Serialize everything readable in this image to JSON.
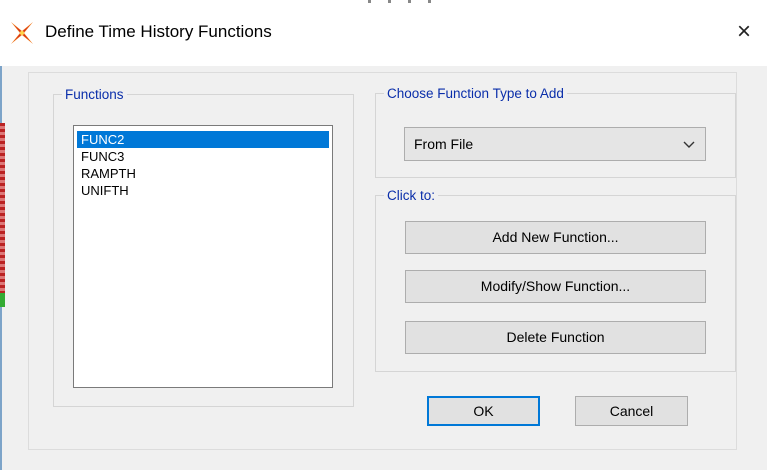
{
  "window": {
    "title": "Define Time History Functions",
    "close_glyph": "×",
    "app_icon": "etabs-logo-icon"
  },
  "functions_group": {
    "label": "Functions",
    "items": [
      "FUNC2",
      "FUNC3",
      "RAMPTH",
      "UNIFTH"
    ],
    "selected": "FUNC2"
  },
  "type_group": {
    "label": "Choose  Function Type to Add",
    "selected_value": "From File"
  },
  "click_group": {
    "label": "Click to:",
    "add_label": "Add New Function...",
    "modify_label": "Modify/Show Function...",
    "delete_label": "Delete Function"
  },
  "footer": {
    "ok_label": "OK",
    "cancel_label": "Cancel"
  },
  "colors": {
    "selection": "#0078d7",
    "group_label": "#0a2eaa",
    "icon_orange": "#f07818",
    "icon_red": "#d02020"
  }
}
